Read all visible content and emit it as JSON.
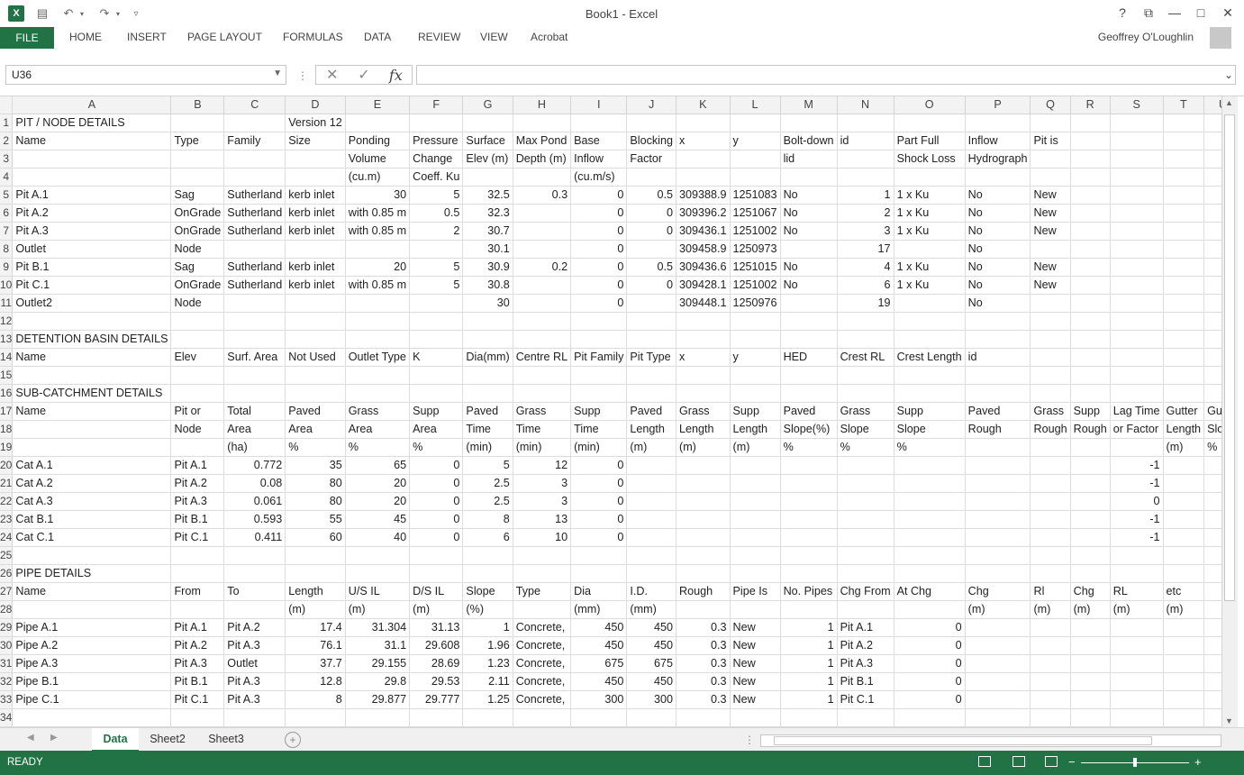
{
  "window": {
    "title": "Book1 - Excel",
    "icon_letter": "X",
    "help": "?",
    "restore": "⧉",
    "minimize": "—",
    "maximize": "□",
    "close": "✕"
  },
  "quick_access": {
    "save": "💾",
    "undo": "↶",
    "redo": "↷",
    "customize": "⁼"
  },
  "ribbon": {
    "file": "FILE",
    "tabs": [
      "HOME",
      "INSERT",
      "PAGE LAYOUT",
      "FORMULAS",
      "DATA",
      "REVIEW",
      "VIEW",
      "Acrobat"
    ],
    "user": "Geoffrey O'Loughlin"
  },
  "formula_bar": {
    "name_box": "U36",
    "formula": "",
    "fx": "fx",
    "cancel": "✕",
    "enter": "✓"
  },
  "columns": [
    "A",
    "B",
    "C",
    "D",
    "E",
    "F",
    "G",
    "H",
    "I",
    "J",
    "K",
    "L",
    "M",
    "N",
    "O",
    "P",
    "Q",
    "R",
    "S",
    "T",
    "U"
  ],
  "rows": [
    [
      "PIT / NODE DETAILS",
      "",
      "",
      "Version 12",
      "",
      "",
      "",
      "",
      "",
      "",
      "",
      "",
      "",
      "",
      "",
      "",
      "",
      "",
      "",
      "",
      ""
    ],
    [
      "Name",
      "Type",
      "Family",
      "Size",
      "Ponding",
      "Pressure",
      "Surface",
      "Max Pond",
      "Base",
      "Blocking",
      "x",
      "y",
      "Bolt-down",
      "id",
      "Part Full",
      "Inflow",
      "Pit is",
      "",
      "",
      "",
      ""
    ],
    [
      "",
      "",
      "",
      "",
      "Volume",
      "Change",
      "Elev (m)",
      "Depth (m)",
      "Inflow",
      "Factor",
      "",
      "",
      "lid",
      "",
      "Shock Loss",
      "Hydrograph",
      "",
      "",
      "",
      "",
      ""
    ],
    [
      "",
      "",
      "",
      "",
      "(cu.m)",
      "Coeff. Ku",
      "",
      "",
      "(cu.m/s)",
      "",
      "",
      "",
      "",
      "",
      "",
      "",
      "",
      "",
      "",
      "",
      ""
    ],
    [
      "Pit A.1",
      "Sag",
      "Sutherland",
      "kerb inlet",
      "30",
      "5",
      "32.5",
      "0.3",
      "0",
      "0.5",
      "309388.9",
      "1251083",
      "No",
      "1",
      "1 x Ku",
      "No",
      "New",
      "",
      "",
      "",
      ""
    ],
    [
      "Pit A.2",
      "OnGrade",
      "Sutherland",
      "kerb inlet",
      "with 0.85 m",
      "0.5",
      "32.3",
      "",
      "0",
      "0",
      "309396.2",
      "1251067",
      "No",
      "2",
      "1 x Ku",
      "No",
      "New",
      "",
      "",
      "",
      ""
    ],
    [
      "Pit A.3",
      "OnGrade",
      "Sutherland",
      "kerb inlet",
      "with 0.85 m",
      "2",
      "30.7",
      "",
      "0",
      "0",
      "309436.1",
      "1251002",
      "No",
      "3",
      "1 x Ku",
      "No",
      "New",
      "",
      "",
      "",
      ""
    ],
    [
      "Outlet",
      "Node",
      "",
      "",
      "",
      "",
      "30.1",
      "",
      "0",
      "",
      "309458.9",
      "1250973",
      "",
      "17",
      "",
      "No",
      "",
      "",
      "",
      "",
      ""
    ],
    [
      "Pit B.1",
      "Sag",
      "Sutherland",
      "kerb inlet",
      "20",
      "5",
      "30.9",
      "0.2",
      "0",
      "0.5",
      "309436.6",
      "1251015",
      "No",
      "4",
      "1 x Ku",
      "No",
      "New",
      "",
      "",
      "",
      ""
    ],
    [
      "Pit C.1",
      "OnGrade",
      "Sutherland",
      "kerb inlet",
      "with 0.85 m",
      "5",
      "30.8",
      "",
      "0",
      "0",
      "309428.1",
      "1251002",
      "No",
      "6",
      "1 x Ku",
      "No",
      "New",
      "",
      "",
      "",
      ""
    ],
    [
      "Outlet2",
      "Node",
      "",
      "",
      "",
      "",
      "30",
      "",
      "0",
      "",
      "309448.1",
      "1250976",
      "",
      "19",
      "",
      "No",
      "",
      "",
      "",
      "",
      ""
    ],
    [
      "",
      "",
      "",
      "",
      "",
      "",
      "",
      "",
      "",
      "",
      "",
      "",
      "",
      "",
      "",
      "",
      "",
      "",
      "",
      "",
      ""
    ],
    [
      "DETENTION BASIN DETAILS",
      "",
      "",
      "",
      "",
      "",
      "",
      "",
      "",
      "",
      "",
      "",
      "",
      "",
      "",
      "",
      "",
      "",
      "",
      "",
      ""
    ],
    [
      "Name",
      "Elev",
      "Surf. Area",
      "Not Used",
      "Outlet Type",
      "K",
      "Dia(mm)",
      "Centre RL",
      "Pit Family",
      "Pit Type",
      "x",
      "y",
      "HED",
      "Crest RL",
      "Crest Length",
      "id",
      "",
      "",
      "",
      "",
      ""
    ],
    [
      "",
      "",
      "",
      "",
      "",
      "",
      "",
      "",
      "",
      "",
      "",
      "",
      "",
      "",
      "",
      "",
      "",
      "",
      "",
      "",
      ""
    ],
    [
      "SUB-CATCHMENT DETAILS",
      "",
      "",
      "",
      "",
      "",
      "",
      "",
      "",
      "",
      "",
      "",
      "",
      "",
      "",
      "",
      "",
      "",
      "",
      "",
      ""
    ],
    [
      "Name",
      "Pit or",
      "Total",
      "Paved",
      "Grass",
      "Supp",
      "Paved",
      "Grass",
      "Supp",
      "Paved",
      "Grass",
      "Supp",
      "Paved",
      "Grass",
      "Supp",
      "Paved",
      "Grass",
      "Supp",
      "Lag Time",
      "Gutter",
      "Gutter"
    ],
    [
      "",
      "Node",
      "Area",
      "Area",
      "Area",
      "Area",
      "Time",
      "Time",
      "Time",
      "Length",
      "Length",
      "Length",
      "Slope(%)",
      "Slope",
      "Slope",
      "Rough",
      "Rough",
      "Rough",
      "or Factor",
      "Length",
      "Slope"
    ],
    [
      "",
      "",
      "(ha)",
      "%",
      "%",
      "%",
      "(min)",
      "(min)",
      "(min)",
      "(m)",
      "(m)",
      "(m)",
      "%",
      "%",
      "%",
      "",
      "",
      "",
      "",
      "(m)",
      "%"
    ],
    [
      "Cat A.1",
      "Pit A.1",
      "0.772",
      "35",
      "65",
      "0",
      "5",
      "12",
      "0",
      "",
      "",
      "",
      "",
      "",
      "",
      "",
      "",
      "",
      "-1",
      "",
      ""
    ],
    [
      "Cat A.2",
      "Pit A.2",
      "0.08",
      "80",
      "20",
      "0",
      "2.5",
      "3",
      "0",
      "",
      "",
      "",
      "",
      "",
      "",
      "",
      "",
      "",
      "-1",
      "",
      ""
    ],
    [
      "Cat A.3",
      "Pit A.3",
      "0.061",
      "80",
      "20",
      "0",
      "2.5",
      "3",
      "0",
      "",
      "",
      "",
      "",
      "",
      "",
      "",
      "",
      "",
      "0",
      "",
      ""
    ],
    [
      "Cat B.1",
      "Pit B.1",
      "0.593",
      "55",
      "45",
      "0",
      "8",
      "13",
      "0",
      "",
      "",
      "",
      "",
      "",
      "",
      "",
      "",
      "",
      "-1",
      "",
      ""
    ],
    [
      "Cat C.1",
      "Pit C.1",
      "0.411",
      "60",
      "40",
      "0",
      "6",
      "10",
      "0",
      "",
      "",
      "",
      "",
      "",
      "",
      "",
      "",
      "",
      "-1",
      "",
      ""
    ],
    [
      "",
      "",
      "",
      "",
      "",
      "",
      "",
      "",
      "",
      "",
      "",
      "",
      "",
      "",
      "",
      "",
      "",
      "",
      "",
      "",
      ""
    ],
    [
      "PIPE DETAILS",
      "",
      "",
      "",
      "",
      "",
      "",
      "",
      "",
      "",
      "",
      "",
      "",
      "",
      "",
      "",
      "",
      "",
      "",
      "",
      ""
    ],
    [
      "Name",
      "From",
      "To",
      "Length",
      "U/S IL",
      "D/S IL",
      "Slope",
      "Type",
      "Dia",
      "I.D.",
      "Rough",
      "Pipe Is",
      "No. Pipes",
      "Chg From",
      "At Chg",
      "Chg",
      "Rl",
      "Chg",
      "RL",
      "etc",
      ""
    ],
    [
      "",
      "",
      "",
      "(m)",
      "(m)",
      "(m)",
      "(%)",
      "",
      "(mm)",
      "(mm)",
      "",
      "",
      "",
      "",
      "",
      "(m)",
      "(m)",
      "(m)",
      "(m)",
      "(m)",
      ""
    ],
    [
      "Pipe A.1",
      "Pit A.1",
      "Pit A.2",
      "17.4",
      "31.304",
      "31.13",
      "1",
      "Concrete,",
      "450",
      "450",
      "0.3",
      "New",
      "1",
      "Pit A.1",
      "0",
      "",
      "",
      "",
      "",
      "",
      ""
    ],
    [
      "Pipe A.2",
      "Pit A.2",
      "Pit A.3",
      "76.1",
      "31.1",
      "29.608",
      "1.96",
      "Concrete,",
      "450",
      "450",
      "0.3",
      "New",
      "1",
      "Pit A.2",
      "0",
      "",
      "",
      "",
      "",
      "",
      ""
    ],
    [
      "Pipe A.3",
      "Pit A.3",
      "Outlet",
      "37.7",
      "29.155",
      "28.69",
      "1.23",
      "Concrete,",
      "675",
      "675",
      "0.3",
      "New",
      "1",
      "Pit A.3",
      "0",
      "",
      "",
      "",
      "",
      "",
      ""
    ],
    [
      "Pipe B.1",
      "Pit B.1",
      "Pit A.3",
      "12.8",
      "29.8",
      "29.53",
      "2.11",
      "Concrete,",
      "450",
      "450",
      "0.3",
      "New",
      "1",
      "Pit B.1",
      "0",
      "",
      "",
      "",
      "",
      "",
      ""
    ],
    [
      "Pipe C.1",
      "Pit C.1",
      "Pit A.3",
      "8",
      "29.877",
      "29.777",
      "1.25",
      "Concrete,",
      "300",
      "300",
      "0.3",
      "New",
      "1",
      "Pit C.1",
      "0",
      "",
      "",
      "",
      "",
      "",
      ""
    ],
    [
      "",
      "",
      "",
      "",
      "",
      "",
      "",
      "",
      "",
      "",
      "",
      "",
      "",
      "",
      "",
      "",
      "",
      "",
      "",
      "",
      ""
    ]
  ],
  "sheets": {
    "tabs": [
      "Data",
      "Sheet2",
      "Sheet3"
    ],
    "active": "Data",
    "add": "+"
  },
  "status": {
    "ready": "READY",
    "zoom_minus": "−",
    "zoom_plus": "+"
  }
}
